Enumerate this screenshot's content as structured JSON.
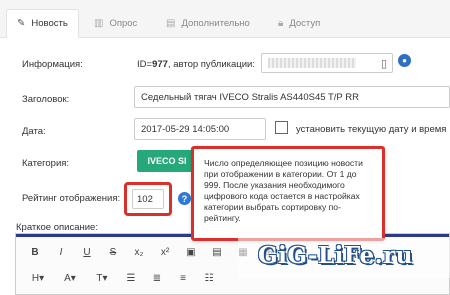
{
  "tabs": [
    {
      "label": "Новость",
      "icon": "pencil-icon"
    },
    {
      "label": "Опрос",
      "icon": "bar-chart-icon"
    },
    {
      "label": "Дополнительно",
      "icon": "document-icon"
    },
    {
      "label": "Доступ",
      "icon": "lock-icon"
    }
  ],
  "form": {
    "info_label": "Информация:",
    "info_id_prefix": "ID=",
    "info_id": "977",
    "info_author_text": ", автор публикации:",
    "title_label": "Заголовок:",
    "title_value": "Седельный тягач IVECO Stralis AS440S45 T/P RR",
    "date_label": "Дата:",
    "date_value": "2017-05-29 14:05:00",
    "date_checkbox_label": "установить текущую дату и время",
    "category_label": "Категория:",
    "category_tag": "IVECO SI",
    "rating_label": "Рейтинг отображения:",
    "rating_value": "102",
    "short_desc_label": "Краткое описание:"
  },
  "tooltip": {
    "text": "Число определяющее позицию новости при отображении в категории. От 1 до 999. После указания необходимого цифрового кода остается в настройках категории выбрать сортировку по-рейтингу."
  },
  "toolbar": {
    "row1": [
      "B",
      "I",
      "U",
      "S",
      "x₂",
      "x²",
      "▣",
      "▤",
      "▦",
      "⊞"
    ],
    "row2": [
      "H▾",
      "A▾",
      "T▾",
      "☰",
      "≣",
      "≡",
      "☷"
    ]
  },
  "watermark": "GiG-LiFe.ru",
  "colors": {
    "highlight": "#d9302c",
    "category": "#27a87a",
    "help": "#2f7ad6"
  }
}
